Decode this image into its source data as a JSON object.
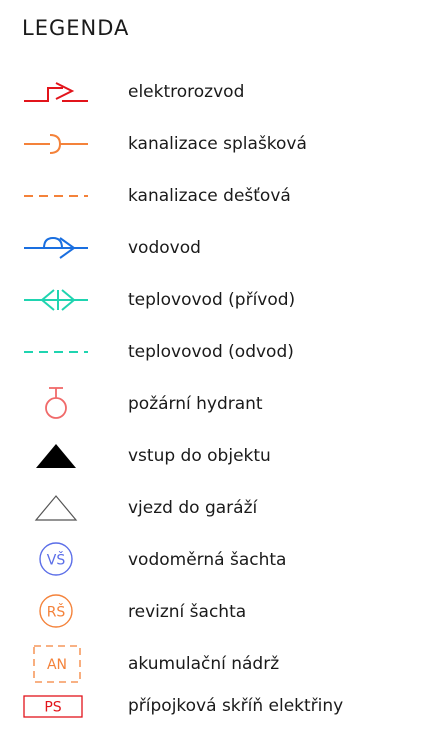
{
  "title": "LEGENDA",
  "items": [
    {
      "label": "elektrorozvod",
      "icon": "electrical-line-icon",
      "color": "#e2141b"
    },
    {
      "label": "kanalizace splašková",
      "icon": "sewage-line-icon",
      "color": "#f4823a"
    },
    {
      "label": "kanalizace dešťová",
      "icon": "storm-drain-line-icon",
      "color": "#f4823a"
    },
    {
      "label": "vodovod",
      "icon": "water-main-icon",
      "color": "#1a6fe0"
    },
    {
      "label": "teplovovod (přívod)",
      "icon": "heating-supply-icon",
      "color": "#1fd4b0"
    },
    {
      "label": "teplovovod (odvod)",
      "icon": "heating-return-icon",
      "color": "#1fd4b0"
    },
    {
      "label": "požární hydrant",
      "icon": "fire-hydrant-icon",
      "color": "#f06a6a"
    },
    {
      "label": "vstup do objektu",
      "icon": "building-entrance-icon",
      "color": "#000000"
    },
    {
      "label": "vjezd do garáží",
      "icon": "garage-entrance-icon",
      "color": "#555555"
    },
    {
      "label": "vodoměrná šachta",
      "icon": "water-meter-shaft-icon",
      "color": "#5b6ee8",
      "abbr": "VŠ"
    },
    {
      "label": "revizní šachta",
      "icon": "inspection-shaft-icon",
      "color": "#f4823a",
      "abbr": "RŠ"
    },
    {
      "label": "akumulační nádrž",
      "icon": "storage-tank-icon",
      "color": "#f4823a",
      "abbr": "AN"
    },
    {
      "label": "přípojková skříň elektřiny",
      "icon": "electric-box-icon",
      "color": "#e2141b",
      "abbr": "PS"
    }
  ]
}
